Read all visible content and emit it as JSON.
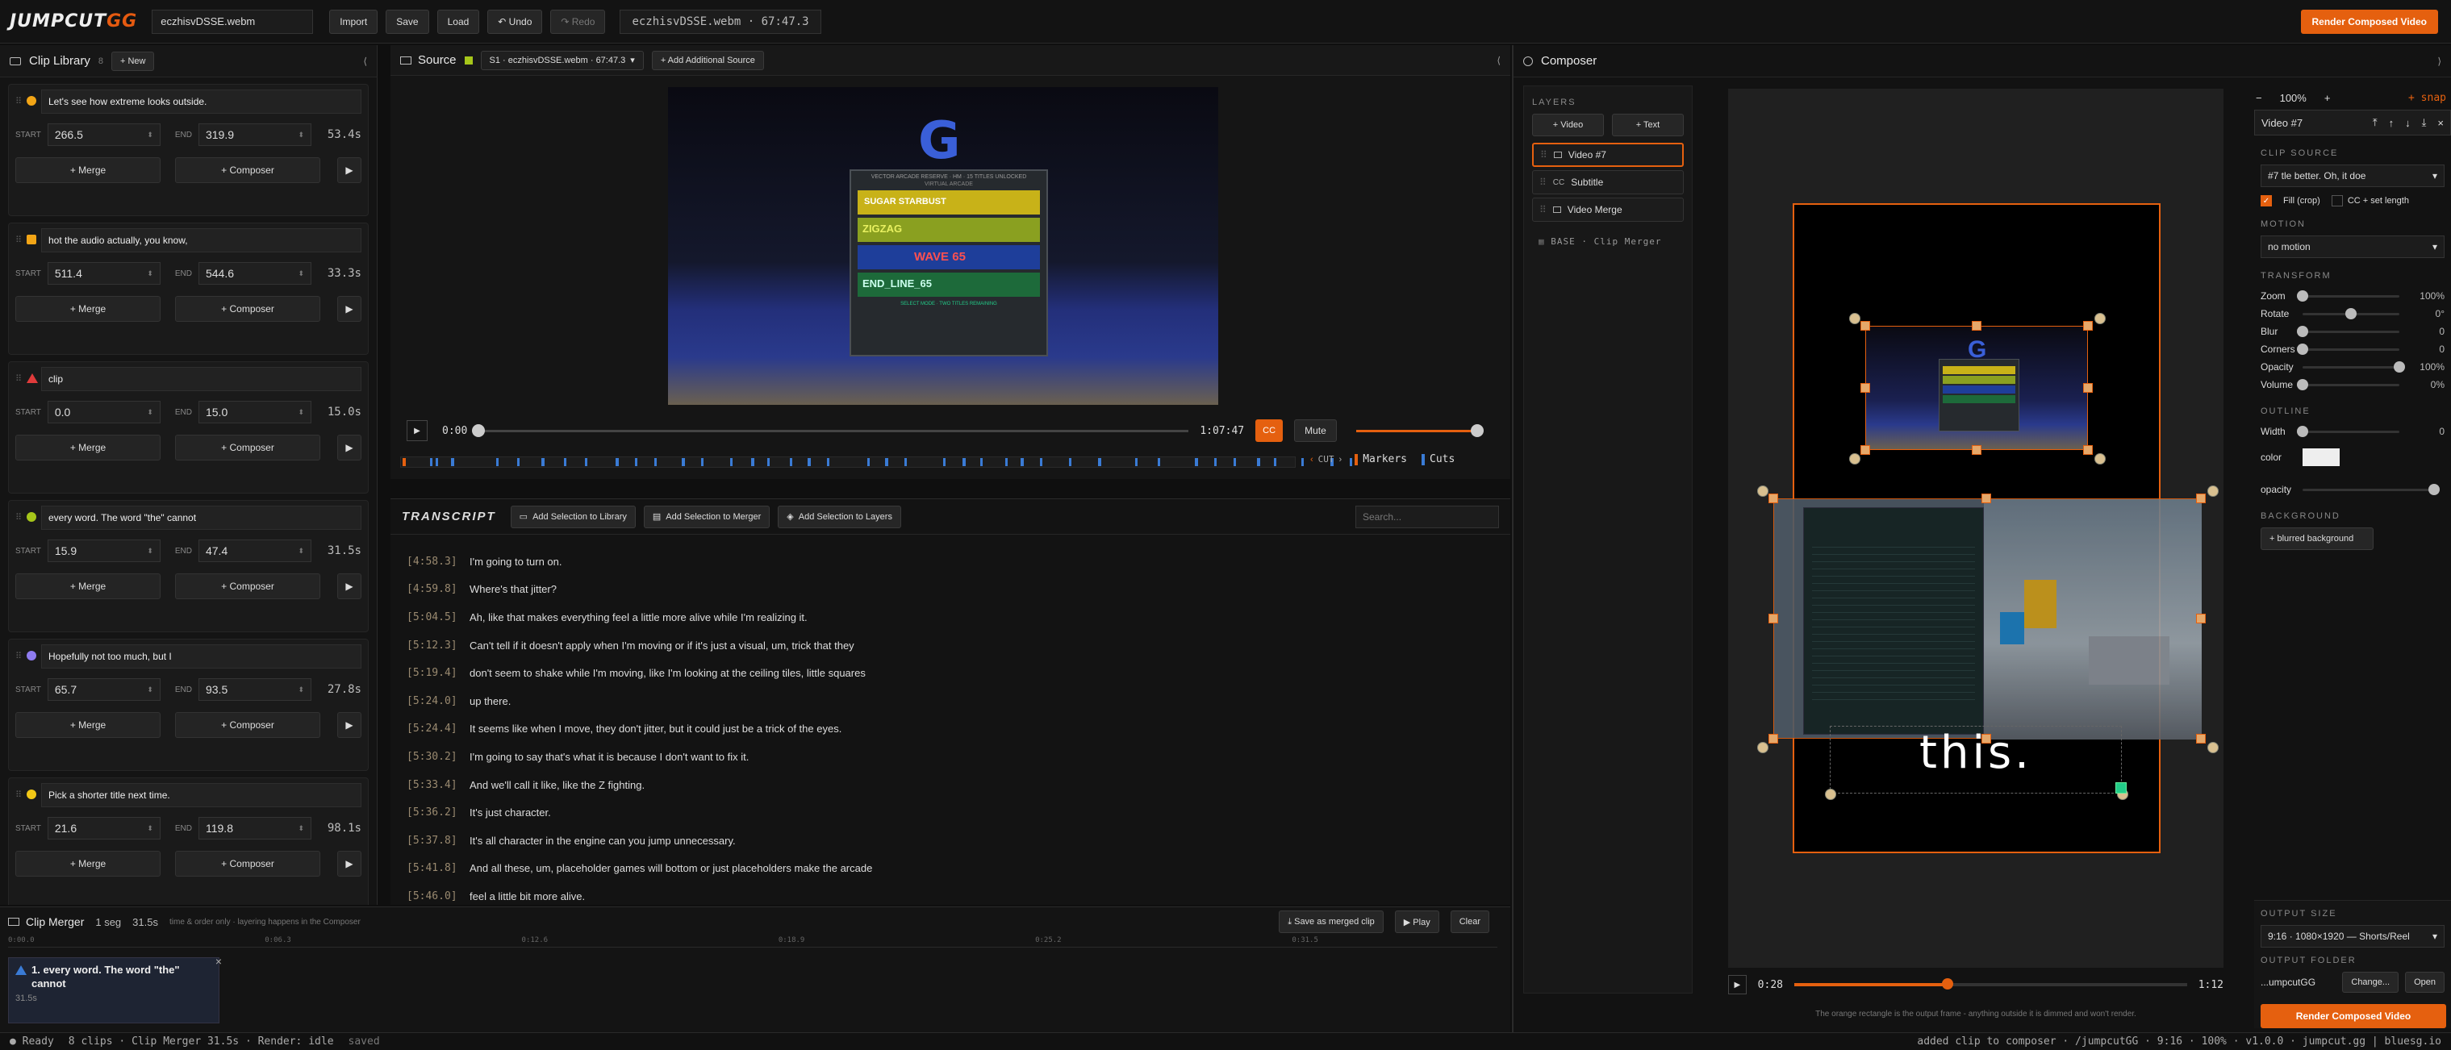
{
  "app": {
    "logo_main": "JUMPCUT",
    "logo_accent": "GG",
    "filename": "eczhisvDSSE.webm",
    "title_info": "eczhisvDSSE.webm · 67:47.3"
  },
  "toolbar": {
    "import": "Import",
    "save": "Save",
    "load": "Load",
    "undo": "↶ Undo",
    "redo": "↷ Redo",
    "render": "Render Composed Video"
  },
  "library": {
    "title": "Clip Library",
    "count": "8",
    "new": "+ New",
    "collapse": "⟨",
    "clips": [
      {
        "title": "Let's see how extreme looks outside.",
        "start": "266.5",
        "end": "319.9",
        "dur": "53.4s",
        "color": "#f2a516",
        "shape": "circle"
      },
      {
        "title": "hot the audio actually, you know,",
        "start": "511.4",
        "end": "544.6",
        "dur": "33.3s",
        "color": "#f2a516",
        "shape": "square"
      },
      {
        "title": "clip",
        "start": "0.0",
        "end": "15.0",
        "dur": "15.0s",
        "color": "#e03b3b",
        "shape": "triangle"
      },
      {
        "title": "every word. The word \"the\" cannot",
        "start": "15.9",
        "end": "47.4",
        "dur": "31.5s",
        "color": "#a6c61a",
        "shape": "circle"
      },
      {
        "title": "Hopefully not too much, but I",
        "start": "65.7",
        "end": "93.5",
        "dur": "27.8s",
        "color": "#8f7cf0",
        "shape": "circle"
      },
      {
        "title": "Pick a shorter title next time.",
        "start": "21.6",
        "end": "119.8",
        "dur": "98.1s",
        "color": "#f2c816",
        "shape": "circle"
      }
    ],
    "start_label": "START",
    "end_label": "END",
    "merge": "+ Merge",
    "composer": "+ Composer",
    "play": "▶"
  },
  "source": {
    "title": "Source",
    "select": "S1 · eczhisvDSSE.webm · 67:47.3",
    "add": "+ Add Additional Source",
    "collapse": "⟨",
    "time_start": "0:00",
    "time_end": "1:07:47",
    "cc": "CC",
    "mute": "Mute",
    "cut": "CUT",
    "markers": "Markers",
    "cuts": "Cuts",
    "thumb": {
      "header": "VECTOR ARCADE RESERVE · HM · 15 TITLES UNLOCKED",
      "sub": "VIRTUAL ARCADE",
      "r1": "SUGAR STARBUST",
      "r2": "ZIGZAG",
      "r3": "WAVE 65",
      "r4": "END_LINE_65",
      "foot": "SELECT MODE · TWO TITLES REMAINING"
    }
  },
  "transcript": {
    "title": "TRANSCRIPT",
    "add_library": "Add Selection to Library",
    "add_merger": "Add Selection to Merger",
    "add_layers": "Add Selection to Layers",
    "search": "Search...",
    "lines": [
      {
        "ts": "[4:58.3]",
        "text": "I'm going to turn on."
      },
      {
        "ts": "[4:59.8]",
        "text": "Where's that jitter?"
      },
      {
        "ts": "[5:04.5]",
        "text": "Ah, like that makes everything feel a little more alive while I'm realizing it."
      },
      {
        "ts": "[5:12.3]",
        "text": "Can't tell if it doesn't apply when I'm moving or if it's just a visual, um, trick that they"
      },
      {
        "ts": "[5:19.4]",
        "text": "don't seem to shake while I'm moving, like I'm looking at the ceiling tiles, little squares"
      },
      {
        "ts": "[5:24.0]",
        "text": "up there."
      },
      {
        "ts": "[5:24.4]",
        "text": "It seems like when I move, they don't jitter, but it could just be a trick of the eyes."
      },
      {
        "ts": "[5:30.2]",
        "text": "I'm going to say that's what it is because I don't want to fix it."
      },
      {
        "ts": "[5:33.4]",
        "text": "And we'll call it like, like the Z fighting."
      },
      {
        "ts": "[5:36.2]",
        "text": "It's just character."
      },
      {
        "ts": "[5:37.8]",
        "text": "It's all character in the engine can you jump unnecessary."
      },
      {
        "ts": "[5:41.8]",
        "text": "And all these, um, placeholder games will bottom or just placeholders make the arcade"
      },
      {
        "ts": "[5:46.0]",
        "text": "feel a little bit more alive."
      }
    ]
  },
  "merger": {
    "title": "Clip Merger",
    "seg": "1 seg",
    "dur": "31.5s",
    "hint": "time & order only · layering happens in the Composer",
    "save": "⤓ Save as merged clip",
    "play": "▶ Play",
    "clear": "Clear",
    "ticks": [
      "0:00.0",
      "0:06.3",
      "0:12.6",
      "0:18.9",
      "0:25.2",
      "0:31.5"
    ],
    "item": {
      "title": "1. every word. The word \"the\" cannot",
      "dur": "31.5s"
    }
  },
  "composer": {
    "title": "Composer",
    "layers_label": "LAYERS",
    "add_video": "+ Video",
    "add_text": "+ Text",
    "layers": [
      {
        "name": "Video #7",
        "kind": "video"
      },
      {
        "name": "Subtitle",
        "kind": "cc"
      },
      {
        "name": "Video Merge",
        "kind": "video"
      }
    ],
    "base": "BASE · Clip Merger",
    "zoom_minus": "−",
    "zoom": "100%",
    "zoom_plus": "+",
    "snap": "+ snap",
    "expand": "⟩",
    "subtitle_text": "this.",
    "time": "0:28",
    "time_end": "1:12",
    "hint": "The orange rectangle is the output frame - anything outside it is dimmed and won't render.",
    "render": "Render Composed Video"
  },
  "inspector": {
    "title": "Video #7",
    "clip_source_label": "CLIP SOURCE",
    "clip_source": "#7 tle better. Oh, it doe",
    "fill": "Fill (crop)",
    "ccset": "CC + set length",
    "motion_label": "MOTION",
    "motion": "no motion",
    "transform_label": "TRANSFORM",
    "transform": [
      {
        "name": "Zoom",
        "value": "100%",
        "pos": 0.0
      },
      {
        "name": "Rotate",
        "value": "0°",
        "pos": 0.5
      },
      {
        "name": "Blur",
        "value": "0",
        "pos": 0.0
      },
      {
        "name": "Corners",
        "value": "0",
        "pos": 0.0
      },
      {
        "name": "Opacity",
        "value": "100%",
        "pos": 1.0
      },
      {
        "name": "Volume",
        "value": "0%",
        "pos": 0.0
      }
    ],
    "outline_label": "OUTLINE",
    "width_label": "Width",
    "width_value": "0",
    "color_label": "color",
    "opacity_label": "opacity",
    "outline_opacity": 0.97,
    "background_label": "BACKGROUND",
    "bg_btn": "+ blurred background",
    "output_size_label": "OUTPUT SIZE",
    "output_size": "9:16 · 1080×1920 — Shorts/Reel",
    "output_folder_label": "OUTPUT FOLDER",
    "folder": "...umpcutGG",
    "change": "Change...",
    "open": "Open"
  },
  "status": {
    "ready": "● Ready",
    "clips": "8 clips · Clip Merger 31.5s · Render: idle",
    "saved": "saved",
    "right": "added clip to composer · /jumpcutGG · 9:16 · 100% · v1.0.0 · jumpcut.gg | bluesg.io"
  },
  "playback": {
    "source_progress": 0.0,
    "source_volume": 1.0,
    "composer_progress": 0.39
  }
}
